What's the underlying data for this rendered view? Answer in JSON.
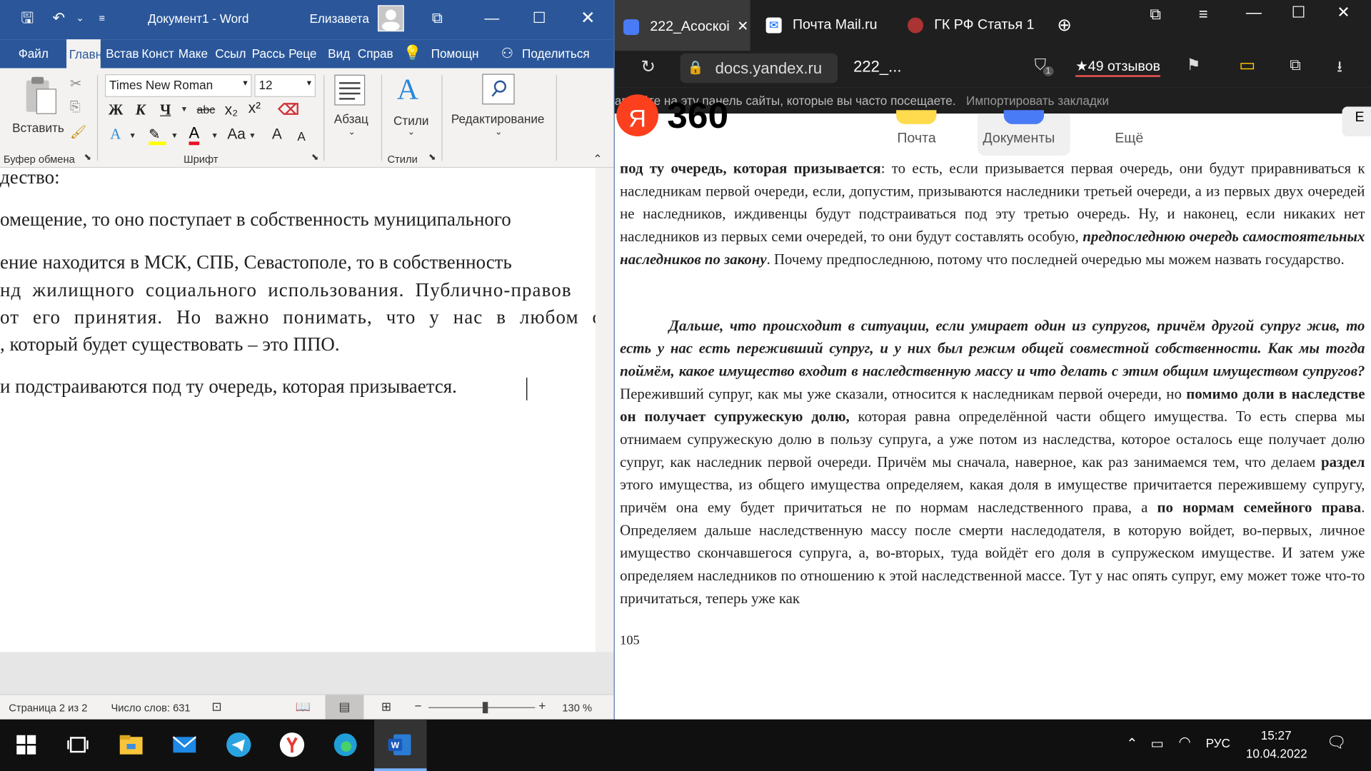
{
  "word": {
    "title": "Документ1 - Word",
    "user": "Елизавета",
    "tabs": {
      "file": "Файл",
      "home": "Главн",
      "insert": "Встав",
      "design": "Конст",
      "layout": "Маке",
      "refs": "Ссыл",
      "mail": "Рассь",
      "review": "Реце",
      "view": "Вид",
      "help": "Справ",
      "tell": "Помощн",
      "share": "Поделиться"
    },
    "ribbon": {
      "paste": "Вставить",
      "clipboard": "Буфер обмена",
      "font_group": "Шрифт",
      "font_name": "Times New Roman",
      "font_size": "12",
      "paragraph": "Абзац",
      "styles": "Стили",
      "styles_group": "Стили",
      "editing": "Редактирование",
      "bold": "Ж",
      "italic": "К",
      "underline": "Ч",
      "strike": "abc",
      "sub": "x₂",
      "sup": "x²",
      "case": "Aa",
      "grow": "A",
      "shrink": "A"
    },
    "doc_lines": [
      "дество:",
      "омещение, то оно поступает в собственность муниципального",
      "ение находится в МСК, СПБ, Севастополе, то в собственность",
      "нд жилищного социального использования. Публично-правов",
      "от его принятия. Но важно понимать, что у нас в любом сл",
      ", который будет существовать – это ППО.",
      "и подстраиваются под ту очередь, которая призывается."
    ],
    "status": {
      "page": "Страница 2 из 2",
      "words": "Число слов: 631",
      "zoom": "130 %"
    }
  },
  "browser": {
    "tabs": [
      "222_Асоскоі",
      "Почта Mail.ru",
      "ГК РФ Статья 1"
    ],
    "address_host": "docs.yandex.ru",
    "address_path": "222_...",
    "reviews": "★49 отзывов",
    "shield_count": "1",
    "bookmarks_bar": "авляйте на эту панель сайты, которые вы часто посещаете.",
    "import": "Импортировать закладки",
    "yandex_logo": "Я",
    "yandex_360": "360",
    "nav": [
      "Почта",
      "Документы",
      "Ещё"
    ],
    "p1_bold_lead": "под ту очередь, которая призывается",
    "p1_text": ": то есть, если призывается первая очередь, они будут приравниваться к наследникам первой очереди, если, допустим, призываются наследники третьей очереди, а из первых двух очередей не наследников, иждивенцы будут подстраиваться под эту третью очередь. Ну, и наконец, если никаких нет наследников из первых семи очередей, то они будут составлять особую, ",
    "p1_bi": "предпоследнюю очередь самостоятельных наследников по закону",
    "p1_end": ". Почему предпоследнюю, потому что последней очередью мы можем назвать государство.",
    "p2_bi": "Дальше, что происходит в ситуации, если умирает один из супругов, причём другой супруг жив, то есть у нас есть переживший супруг, и у них был режим общей совместной собственности. Как мы тогда поймём, какое имущество входит в наследственную массу и что делать с этим общим имуществом супругов?",
    "p2_a": " Переживший супруг, как мы уже сказали, относится к наследникам первой очереди, но ",
    "p2_b": "помимо доли в наследстве он получает супружескую долю,",
    "p2_c": " которая равна определённой части общего имущества. То есть сперва мы отнимаем супружескую долю в пользу супруга, а уже потом из наследства, которое осталось еще получает долю супруг, как наследник первой очереди. Причём мы сначала, наверное, как раз занимаемся тем, что делаем ",
    "p2_d": "раздел",
    "p2_e": " этого имущества, из общего имущества определяем, какая доля в имуществе причитается пережившему супругу, причём она ему будет причитаться не по нормам наследственного права, а ",
    "p2_f": "по нормам семейного права",
    "p2_g": ". Определяем дальше наследственную массу после смерти наследодателя, в которую войдет, во-первых, личное имущество скончавшегося супруга, а, во-вторых, туда войдёт его доля в супружеском имуществе.  И затем уже определяем наследников по отношению к этой наследственной массе. Тут у нас опять супруг, ему может тоже что-то причитаться, теперь уже как",
    "page_num": "105"
  },
  "taskbar": {
    "lang": "РУС",
    "time": "15:27",
    "date": "10.04.2022"
  },
  "colors": {
    "word_blue": "#2b579a",
    "yandex_red": "#fc3f1d",
    "taskbar": "#101010"
  }
}
